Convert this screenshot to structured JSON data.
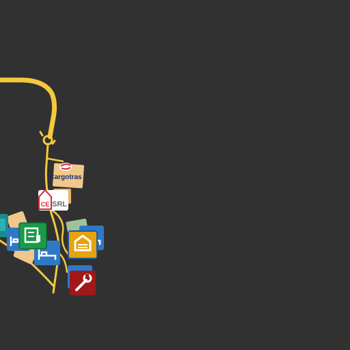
{
  "map": {
    "background": "#313131",
    "road_color": "#f5c93c"
  },
  "company_labels": {
    "cargotras": "Cargotras",
    "srl_a": "CE",
    "srl_b": "SRL"
  },
  "markers": [
    {
      "name": "company-cargotras-marker",
      "color": "#f0c98a"
    },
    {
      "name": "company-srl-marker",
      "color": "#ffffff"
    },
    {
      "name": "hotel-icon",
      "color": "#2f78c8"
    },
    {
      "name": "truck-dealer-icon",
      "color": "#1a9a4a"
    },
    {
      "name": "garage-icon",
      "color": "#e8a20a"
    },
    {
      "name": "service-icon",
      "color": "#a01818"
    }
  ]
}
